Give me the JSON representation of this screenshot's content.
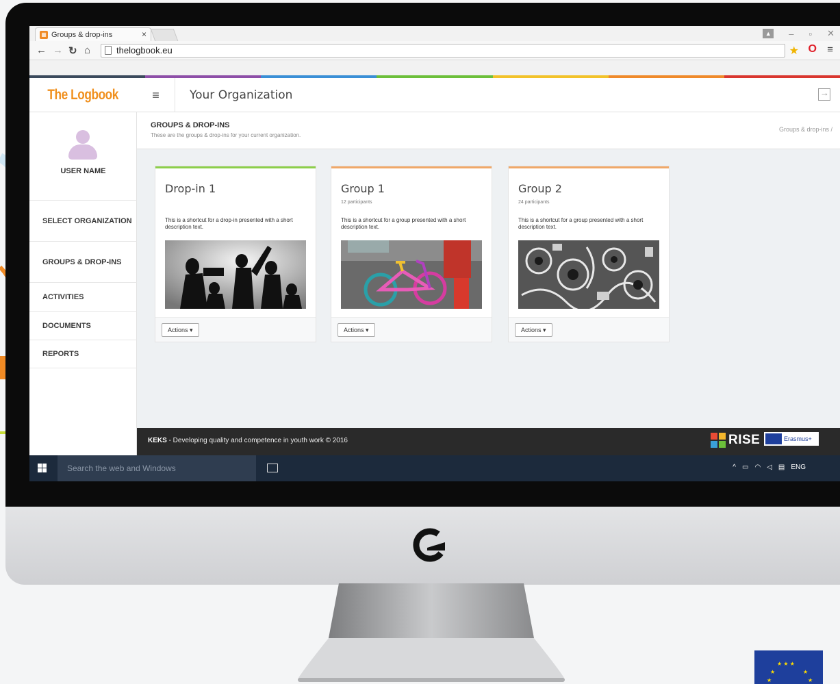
{
  "browser": {
    "tab_title": "Groups & drop-ins",
    "tab_close": "×",
    "url": "thelogbook.eu"
  },
  "app": {
    "logo": "The Logbook",
    "org_title": "Your Organization",
    "user_name": "USER NAME",
    "menu": [
      "SELECT ORGANIZATION",
      "GROUPS & DROP-INS",
      "ACTIVITIES",
      "DOCUMENTS",
      "REPORTS"
    ]
  },
  "page": {
    "title": "GROUPS & DROP-INS",
    "subtitle": "These are the groups & drop-ins for your current organization.",
    "breadcrumb": "Groups & drop-ins /"
  },
  "cards": [
    {
      "title": "Drop-in 1",
      "meta": "",
      "description": "This is a shortcut for a drop-in presented with a short description text.",
      "action": "Actions ▾",
      "accent": "#8ccf4a"
    },
    {
      "title": "Group 1",
      "meta": "12 participants",
      "description": "This is a shortcut for a group presented with a short description text.",
      "action": "Actions ▾",
      "accent": "#f0a868"
    },
    {
      "title": "Group 2",
      "meta": "24 participants",
      "description": "This is a shortcut for a group presented with a short description text.",
      "action": "Actions ▾",
      "accent": "#f0a868"
    }
  ],
  "footer": {
    "brand": "KEKS",
    "text": " - Developing quality and competence in youth work © 2016",
    "rise": "RISE",
    "erasmus": "Erasmus+"
  },
  "taskbar": {
    "search_placeholder": "Search the web and Windows",
    "language": "ENG"
  },
  "colors": {
    "accent": "#f0901e",
    "rainbow": [
      "#3b4a5c",
      "#8e4fa8",
      "#3a8fd6",
      "#6cbf3a",
      "#f2c22a",
      "#ef8a2a",
      "#d9362f"
    ]
  }
}
